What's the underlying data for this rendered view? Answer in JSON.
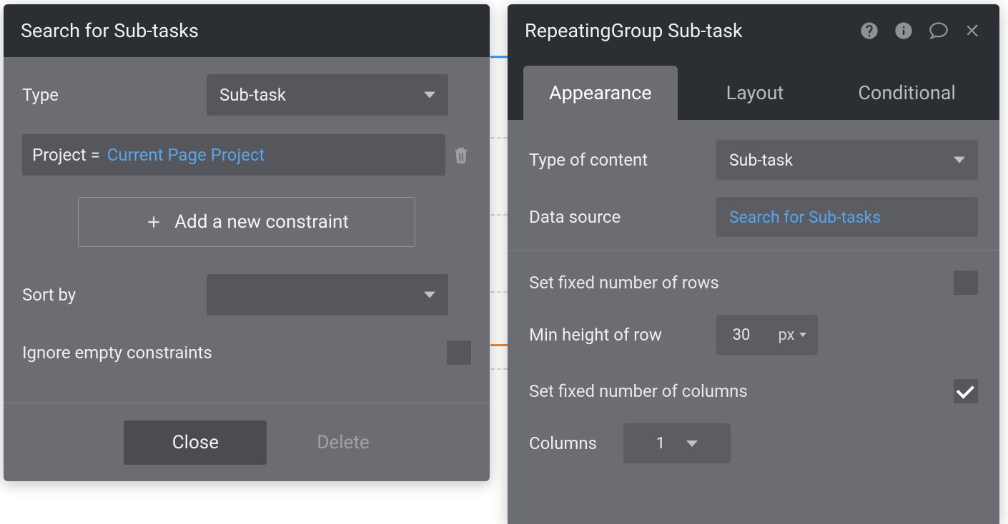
{
  "leftPanel": {
    "title": "Search for Sub-tasks",
    "typeLabel": "Type",
    "typeValue": "Sub-task",
    "constraint": {
      "field": "Project =",
      "expr": "Current Page Project"
    },
    "addConstraintLabel": "Add a new constraint",
    "sortByLabel": "Sort by",
    "sortByValue": "",
    "ignoreEmptyLabel": "Ignore empty constraints",
    "ignoreEmptyChecked": false,
    "closeLabel": "Close",
    "deleteLabel": "Delete"
  },
  "rightPanel": {
    "title": "RepeatingGroup Sub-task",
    "tabs": {
      "appearance": "Appearance",
      "layout": "Layout",
      "conditional": "Conditional",
      "active": "appearance"
    },
    "typeOfContentLabel": "Type of content",
    "typeOfContentValue": "Sub-task",
    "dataSourceLabel": "Data source",
    "dataSourceValue": "Search for Sub-tasks",
    "fixedRowsLabel": "Set fixed number of rows",
    "fixedRowsChecked": false,
    "minRowHeightLabel": "Min height of row",
    "minRowHeightValue": "30",
    "minRowHeightUnit": "px",
    "fixedColsLabel": "Set fixed number of columns",
    "fixedColsChecked": true,
    "columnsLabel": "Columns",
    "columnsValue": "1"
  }
}
